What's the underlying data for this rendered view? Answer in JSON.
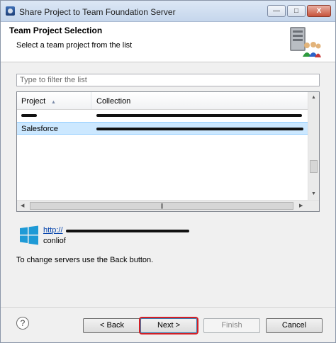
{
  "window": {
    "title": "Share Project to Team Foundation Server",
    "controls": {
      "minimize": "—",
      "maximize": "□",
      "close": "X"
    }
  },
  "banner": {
    "title": "Team Project Selection",
    "subtitle": "Select a team project from the list",
    "icon": "server-users-icon"
  },
  "filter": {
    "value": "",
    "placeholder": "Type to filter the list"
  },
  "table": {
    "columns": [
      "Project",
      "Collection"
    ],
    "rows": [
      {
        "project": "",
        "collection": "",
        "selected": false
      },
      {
        "project": "Salesforce",
        "collection": "",
        "selected": true
      }
    ]
  },
  "server": {
    "icon": "windows-logo-icon",
    "url": "http://",
    "user": "conliof"
  },
  "hint": "To change servers use the Back button.",
  "buttons": {
    "help": "?",
    "back": "< Back",
    "next": "Next >",
    "finish": "Finish",
    "cancel": "Cancel"
  },
  "colors": {
    "selection": "#cce8ff",
    "highlight_box": "#d21f26",
    "link": "#0645ad",
    "windows_logo": "#1e9ad6"
  }
}
